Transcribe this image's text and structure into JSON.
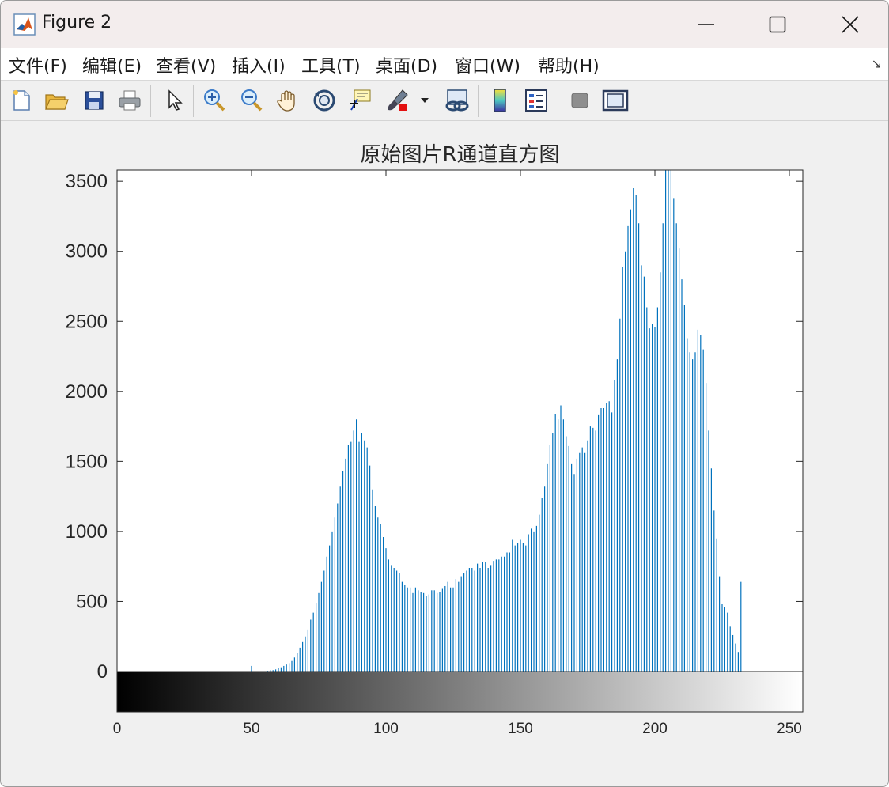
{
  "window": {
    "title": "Figure 2"
  },
  "menu": [
    {
      "label": "文件(F)"
    },
    {
      "label": "编辑(E)"
    },
    {
      "label": "查看(V)"
    },
    {
      "label": "插入(I)"
    },
    {
      "label": "工具(T)"
    },
    {
      "label": "桌面(D)"
    },
    {
      "label": "窗口(W)"
    },
    {
      "label": "帮助(H)"
    }
  ],
  "toolbar_icons": [
    "new-figure-icon",
    "open-file-icon",
    "save-icon",
    "print-icon",
    "select-arrow-icon",
    "zoom-in-icon",
    "zoom-out-icon",
    "pan-hand-icon",
    "rotate-3d-icon",
    "data-cursor-icon",
    "brush-icon",
    "link-plot-icon",
    "colorbar-icon",
    "legend-icon",
    "hide-plot-tools-icon",
    "show-plot-tools-icon"
  ],
  "colors": {
    "bar": "#0072bd",
    "axes_bg": "#ffffff",
    "figure_bg": "#f0f0f0"
  },
  "chart_data": {
    "type": "bar",
    "title": "原始图片R通道直方图",
    "xlabel": "",
    "ylabel": "",
    "xlim": [
      0,
      255
    ],
    "ylim": [
      0,
      3580
    ],
    "xticks": [
      0,
      50,
      100,
      150,
      200,
      250
    ],
    "yticks": [
      0,
      500,
      1000,
      1500,
      2000,
      2500,
      3000,
      3500
    ],
    "grid": false,
    "colorbar": "grayscale 0-255 strip below axis",
    "series": [
      {
        "x_start": 0,
        "values": [
          0,
          0,
          0,
          0,
          0,
          0,
          0,
          0,
          0,
          0,
          0,
          0,
          0,
          0,
          0,
          0,
          0,
          0,
          0,
          0,
          0,
          0,
          0,
          0,
          0,
          0,
          0,
          0,
          0,
          0,
          0,
          0,
          0,
          0,
          0,
          0,
          0,
          0,
          0,
          0,
          0,
          0,
          0,
          0,
          0,
          0,
          0,
          0,
          0,
          0,
          40,
          0,
          0,
          0,
          0,
          0,
          5,
          10,
          10,
          15,
          25,
          30,
          40,
          50,
          60,
          75,
          100,
          130,
          170,
          210,
          250,
          300,
          370,
          420,
          490,
          560,
          640,
          720,
          820,
          900,
          1000,
          1100,
          1200,
          1320,
          1430,
          1520,
          1620,
          1640,
          1720,
          1800,
          1640,
          1700,
          1650,
          1600,
          1470,
          1300,
          1180,
          1100,
          1050,
          960,
          880,
          800,
          760,
          740,
          720,
          700,
          640,
          620,
          600,
          600,
          560,
          600,
          580,
          570,
          560,
          540,
          550,
          580,
          580,
          560,
          570,
          590,
          610,
          640,
          600,
          600,
          660,
          640,
          680,
          700,
          720,
          740,
          740,
          720,
          770,
          740,
          780,
          780,
          740,
          760,
          790,
          800,
          800,
          820,
          820,
          850,
          850,
          940,
          900,
          920,
          940,
          920,
          900,
          980,
          1020,
          1000,
          1040,
          1120,
          1240,
          1320,
          1480,
          1620,
          1700,
          1840,
          1800,
          1900,
          1800,
          1680,
          1610,
          1480,
          1410,
          1520,
          1560,
          1600,
          1560,
          1650,
          1750,
          1740,
          1720,
          1830,
          1880,
          1880,
          1920,
          1930,
          1850,
          2080,
          2230,
          2520,
          2890,
          3000,
          3180,
          3300,
          3450,
          3400,
          3200,
          2900,
          2820,
          2600,
          2450,
          2480,
          2460,
          2600,
          2850,
          3200,
          3580,
          3580,
          3580,
          3380,
          3200,
          3020,
          2800,
          2620,
          2380,
          2280,
          2230,
          2280,
          2440,
          2400,
          2300,
          2060,
          1720,
          1450,
          1150,
          950,
          680,
          480,
          460,
          420,
          320,
          260,
          200,
          140,
          640
        ]
      }
    ]
  }
}
